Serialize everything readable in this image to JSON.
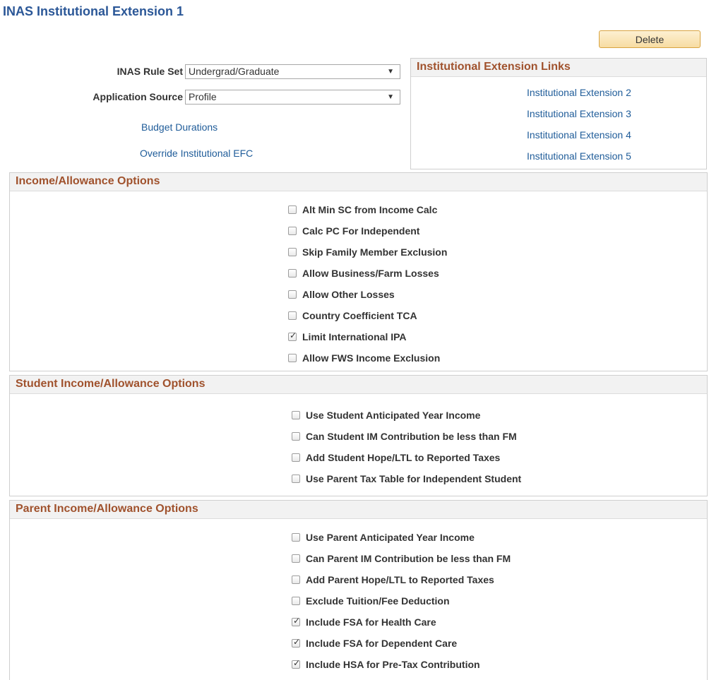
{
  "page": {
    "title": "INAS Institutional Extension 1",
    "delete_label": "Delete"
  },
  "form": {
    "rule_set": {
      "label": "INAS Rule Set",
      "value": "Undergrad/Graduate"
    },
    "app_source": {
      "label": "Application Source",
      "value": "Profile"
    },
    "links": [
      "Budget Durations",
      "Override Institutional EFC"
    ]
  },
  "ext_links": {
    "title": "Institutional Extension Links",
    "items": [
      "Institutional Extension 2",
      "Institutional Extension 3",
      "Institutional Extension 4",
      "Institutional Extension 5"
    ]
  },
  "income": {
    "title": "Income/Allowance Options",
    "options": [
      {
        "label": "Alt Min SC from Income Calc",
        "checked": false
      },
      {
        "label": "Calc PC For Independent",
        "checked": false
      },
      {
        "label": "Skip Family Member Exclusion",
        "checked": false
      },
      {
        "label": "Allow Business/Farm Losses",
        "checked": false
      },
      {
        "label": "Allow Other Losses",
        "checked": false
      },
      {
        "label": "Country Coefficient TCA",
        "checked": false
      },
      {
        "label": "Limit International IPA",
        "checked": true
      },
      {
        "label": "Allow FWS Income Exclusion",
        "checked": false
      }
    ]
  },
  "student": {
    "title": "Student Income/Allowance Options",
    "options": [
      {
        "label": "Use Student Anticipated Year Income",
        "checked": false
      },
      {
        "label": "Can Student IM Contribution be less than FM",
        "checked": false
      },
      {
        "label": "Add Student Hope/LTL to Reported Taxes",
        "checked": false
      },
      {
        "label": "Use Parent Tax Table for Independent Student",
        "checked": false
      }
    ]
  },
  "parent": {
    "title": "Parent Income/Allowance Options",
    "options": [
      {
        "label": "Use Parent Anticipated Year Income",
        "checked": false
      },
      {
        "label": "Can Parent IM Contribution be less than FM",
        "checked": false
      },
      {
        "label": "Add Parent Hope/LTL to Reported Taxes",
        "checked": false
      },
      {
        "label": "Exclude Tuition/Fee Deduction",
        "checked": false
      },
      {
        "label": "Include FSA for Health Care",
        "checked": true
      },
      {
        "label": "Include FSA for Dependent Care",
        "checked": true
      },
      {
        "label": "Include HSA for Pre-Tax Contribution",
        "checked": true
      }
    ]
  }
}
